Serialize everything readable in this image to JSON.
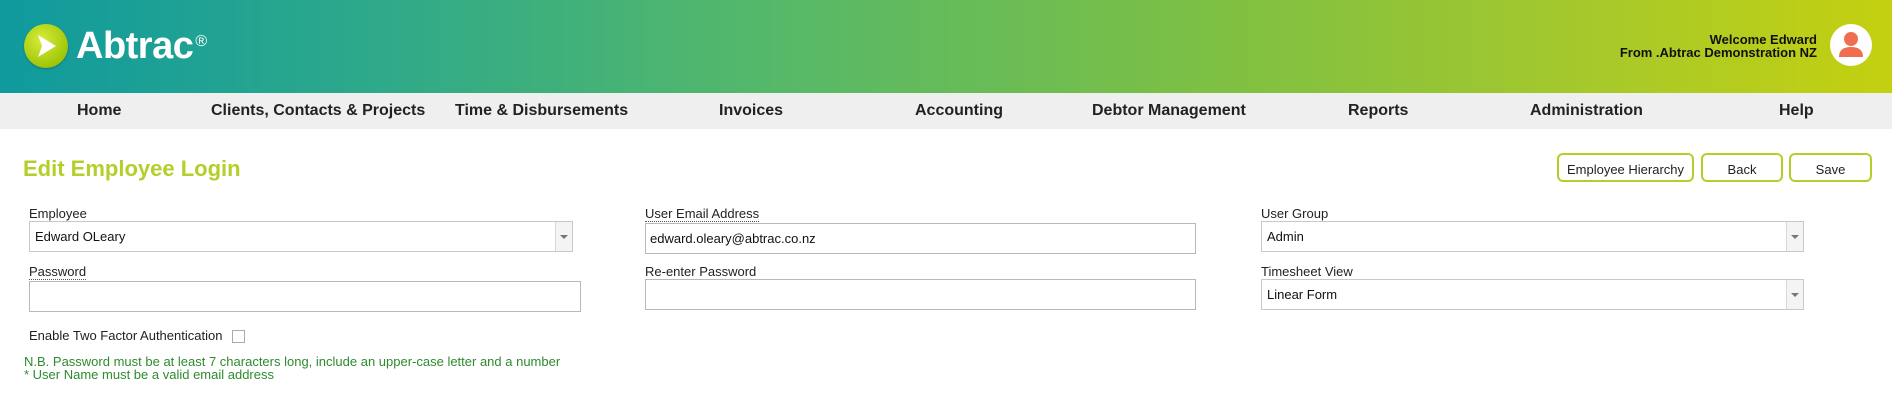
{
  "app": {
    "brand": "Abtrac",
    "brand_mark": "®",
    "welcome_line1": "Welcome Edward",
    "welcome_line2": "From .Abtrac Demonstration NZ",
    "colors": {
      "accent": "#b5cf2a",
      "note": "#2e8b2e",
      "avatar": "#f06d4f"
    }
  },
  "nav": {
    "items": [
      {
        "label": "Home"
      },
      {
        "label": "Clients, Contacts & Projects"
      },
      {
        "label": "Time & Disbursements"
      },
      {
        "label": "Invoices"
      },
      {
        "label": "Accounting"
      },
      {
        "label": "Debtor Management"
      },
      {
        "label": "Reports"
      },
      {
        "label": "Administration"
      },
      {
        "label": "Help"
      }
    ]
  },
  "page": {
    "title": "Edit Employee Login",
    "buttons": {
      "hierarchy": "Employee Hierarchy",
      "back": "Back",
      "save": "Save"
    }
  },
  "form": {
    "employee": {
      "label": "Employee",
      "value": "Edward OLeary"
    },
    "email": {
      "label": "User Email Address",
      "value": "edward.oleary@abtrac.co.nz"
    },
    "user_group": {
      "label": "User Group",
      "value": "Admin"
    },
    "password": {
      "label": "Password",
      "value": ""
    },
    "reenter_password": {
      "label": "Re-enter Password",
      "value": ""
    },
    "timesheet_view": {
      "label": "Timesheet View",
      "value": "Linear Form"
    },
    "two_factor": {
      "label": "Enable Two Factor Authentication",
      "checked": false
    }
  },
  "notes": {
    "line1": "N.B. Password must be at least 7 characters long, include an upper-case letter and a number",
    "line2": "* User Name must be a valid email address"
  }
}
